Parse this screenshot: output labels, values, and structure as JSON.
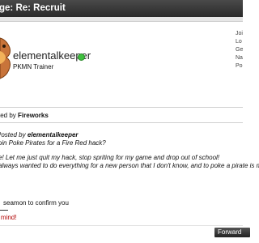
{
  "page": {
    "title": "ge: Re: Recruit"
  },
  "post": {
    "username": "elementalkeeper",
    "user_title": "PKMN Trainer",
    "user_info_labels": [
      "Joi",
      "Lo",
      "Ge",
      "Na",
      "Po"
    ],
    "posted_by_prefix": "ted by ",
    "posted_by_name": "Fireworks",
    "quote_line1_prefix": "Posted by ",
    "quote_line1_name": "elementalkeeper",
    "quote_line2": "join Poke Pirates for a Fire Red hack?",
    "quote_line3": "e! Let me just quit my hack, stop spriting for my game and drop out of school!",
    "quote_line4": "always wanted to do everything for a new person that I don't know, and to poke a pirate is my li",
    "reply_line1": "seamon to confirm you",
    "reply_line2": "r mind!"
  },
  "actions": {
    "forward_label": "Forward"
  },
  "colors": {
    "online": "#3fbf3f",
    "reply_red": "#b00000"
  }
}
